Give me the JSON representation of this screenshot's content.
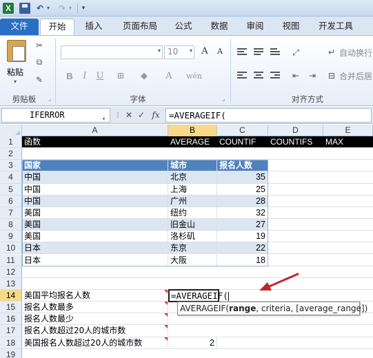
{
  "titlebar": {
    "app_logo": "X",
    "undo_icon": "↶",
    "redo_icon": "↷"
  },
  "ribbon_tabs": [
    "文件",
    "开始",
    "插入",
    "页面布局",
    "公式",
    "数据",
    "审阅",
    "视图",
    "开发工具"
  ],
  "ribbon": {
    "paste_label": "粘贴",
    "clipboard_group": "剪贴板",
    "font_group": "字体",
    "alignment_group": "对齐方式",
    "font_size": "10",
    "wrap_text": "自动换行",
    "merge_center": "合并后居",
    "bold": "B",
    "italic": "I",
    "underline": "U"
  },
  "formula_bar": {
    "name_box": "IFERROR",
    "cancel_icon": "✕",
    "enter_icon": "✓",
    "fx_label": "fx",
    "formula": "=AVERAGEIF("
  },
  "columns": [
    "A",
    "B",
    "C",
    "D",
    "E"
  ],
  "rows": [
    {
      "n": "1",
      "a": "函数",
      "b": "AVERAGE",
      "c": "COUNTIF",
      "d": "COUNTIFS",
      "e": "MAX"
    },
    {
      "n": "2",
      "a": "",
      "b": "",
      "c": ""
    },
    {
      "n": "3",
      "a": "国家",
      "b": "城市",
      "c": "报名人数"
    },
    {
      "n": "4",
      "a": "中国",
      "b": "北京",
      "c": "35"
    },
    {
      "n": "5",
      "a": "中国",
      "b": "上海",
      "c": "25"
    },
    {
      "n": "6",
      "a": "中国",
      "b": "广州",
      "c": "28"
    },
    {
      "n": "7",
      "a": "美国",
      "b": "纽约",
      "c": "32"
    },
    {
      "n": "8",
      "a": "美国",
      "b": "旧金山",
      "c": "27"
    },
    {
      "n": "9",
      "a": "美国",
      "b": "洛杉矶",
      "c": "19"
    },
    {
      "n": "10",
      "a": "日本",
      "b": "东京",
      "c": "22"
    },
    {
      "n": "11",
      "a": "日本",
      "b": "大阪",
      "c": "18"
    },
    {
      "n": "12",
      "a": ""
    },
    {
      "n": "13",
      "a": ""
    },
    {
      "n": "14",
      "a": "美国平均报名人数",
      "b": "=AVERAGEIF("
    },
    {
      "n": "15",
      "a": "报名人数最多"
    },
    {
      "n": "16",
      "a": "报名人数最少"
    },
    {
      "n": "17",
      "a": "报名人数超过20人的城市数"
    },
    {
      "n": "18",
      "a": "美国报名人数超过20人的城市数",
      "b": "2"
    },
    {
      "n": "19",
      "a": ""
    }
  ],
  "tooltip": {
    "fn": "AVERAGEIF(",
    "arg1": "range",
    "rest": ", criteria, [average_range])"
  },
  "colors": {
    "header_fill": "#4f81bd",
    "band_fill": "#dce6f1",
    "arrow": "#c0262d"
  }
}
